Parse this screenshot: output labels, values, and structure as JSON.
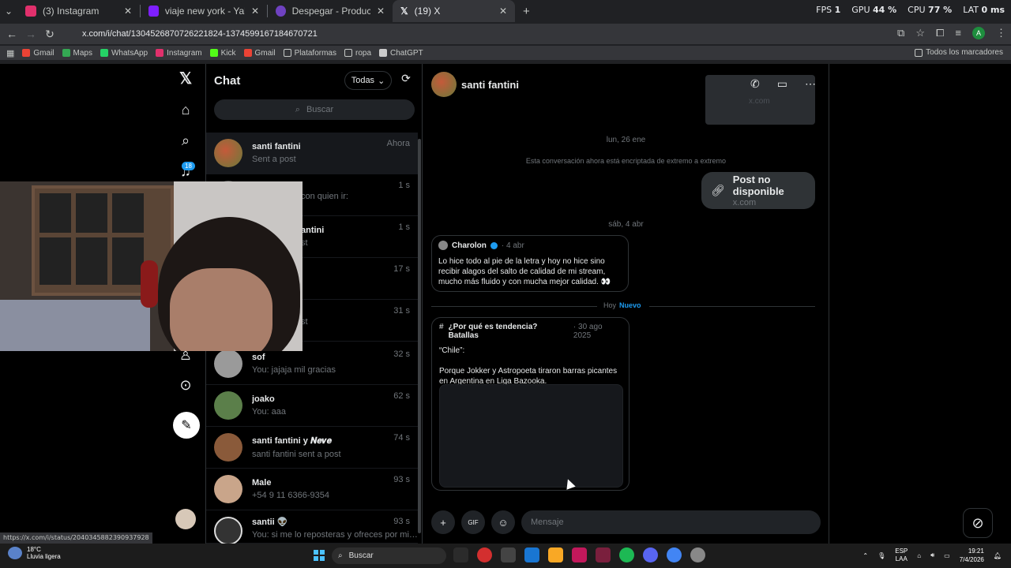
{
  "browser": {
    "tabs": [
      {
        "title": "(3) Instagram",
        "color": "#e1306c"
      },
      {
        "title": "viaje new york - Yahoo Search",
        "color": "#7e1fff"
      },
      {
        "title": "Despegar - Productos Combin",
        "color": "#6f42c1"
      },
      {
        "title": "(19) X",
        "color": "#ffffff"
      }
    ],
    "perf": {
      "fps_label": "FPS",
      "fps": "1",
      "gpu_label": "GPU",
      "gpu": "44 %",
      "cpu_label": "CPU",
      "cpu": "77 %",
      "lat_label": "LAT",
      "lat": "0 ms"
    },
    "url": "x.com/i/chat/1304526870726221824-1374599167184670721",
    "profile_initial": "A",
    "bookmarks": [
      {
        "label": "Gmail",
        "color": "#ea4335"
      },
      {
        "label": "Maps",
        "color": "#34a853"
      },
      {
        "label": "WhatsApp",
        "color": "#25d366"
      },
      {
        "label": "Instagram",
        "color": "#e1306c"
      },
      {
        "label": "Kick",
        "color": "#53fc18"
      },
      {
        "label": "Gmail",
        "color": "#ea4335"
      },
      {
        "label": "Plataformas",
        "color": "#8a8a8a"
      },
      {
        "label": "ropa",
        "color": "#8a8a8a"
      },
      {
        "label": "ChatGPT",
        "color": "#cccccc"
      }
    ],
    "all_bookmarks": "Todos los marcadores",
    "status_url": "https://x.com/i/status/2040345882390937928"
  },
  "nav": {
    "notifications_badge": "18"
  },
  "chatlist": {
    "title": "Chat",
    "filter": "Todas",
    "search_placeholder": "Buscar",
    "conversations": [
      {
        "name": "santi fantini",
        "preview": "Sent a post",
        "time": "Ahora",
        "color": "#a76b4e"
      },
      {
        "name": "",
        "preview": "con quien ir:",
        "time": "1 s",
        "color": "#555555"
      },
      {
        "name": "antini",
        "preview": "st",
        "time": "1 s",
        "color": "#555555"
      },
      {
        "name": "",
        "preview": "",
        "time": "17 s",
        "color": "#555555"
      },
      {
        "name": "",
        "preview": "st",
        "time": "31 s",
        "color": "#555555"
      },
      {
        "name": "sof",
        "preview": "You: jajaja mil gracias",
        "time": "32 s",
        "color": "#9a9a9a"
      },
      {
        "name": "joako",
        "preview": "You: aaa",
        "time": "62 s",
        "color": "#5b7f4a"
      },
      {
        "name": "santi fantini y 𝑵𝒆𝒗𝒆",
        "preview": "santi fantini sent a post",
        "time": "74 s",
        "color": "#8a5a3a"
      },
      {
        "name": "Male",
        "preview": "+54 9 11 6366-9354",
        "time": "93 s",
        "color": "#c9a58a"
      },
      {
        "name": "santii 👽",
        "preview": "You: si me lo reposteras y ofreces por mi t...",
        "time": "93 s",
        "color": "#333333"
      }
    ]
  },
  "chat": {
    "contact_name": "santi fantini",
    "prev_card_source": "x.com",
    "date1": "lun, 26 ene",
    "encryption_notice": "Esta conversación ahora está encriptada de extremo a extremo",
    "post_unavailable": {
      "title": "Post no disponible",
      "source": "x.com"
    },
    "date2": "sáb, 4 abr",
    "quote": {
      "author": "Charolon",
      "date": "· 4 abr",
      "text": "Lo hice todo al pie de la letra y hoy no hice sino recibir alagos del salto de calidad de mi stream, mucho más fluido y con mucha mejor calidad. 👀"
    },
    "today_label": "Hoy",
    "new_label": "Nuevo",
    "trend": {
      "hash": "#",
      "title": "¿Por qué es tendencia? Batallas",
      "date": "· 30 ago 2025",
      "line1": "“Chile”:",
      "line2": "Porque Jokker y Astropoeta tiraron barras picantes en Argentina en Liga Bazooka."
    },
    "message_placeholder": "Mensaje"
  },
  "taskbar": {
    "temp": "18°C",
    "weather": "Lluvia ligera",
    "search": "Buscar",
    "lang1": "ESP",
    "lang2": "LAA",
    "time": "19:21",
    "date": "7/4/2026",
    "apps": [
      "#e0a030",
      "#2b2b2b",
      "#d32f2f",
      "#444444",
      "#1976d2",
      "#f9a825",
      "#c2185b",
      "#7a1f3d",
      "#1db954",
      "#5865f2",
      "#4285f4",
      "#888888"
    ]
  }
}
